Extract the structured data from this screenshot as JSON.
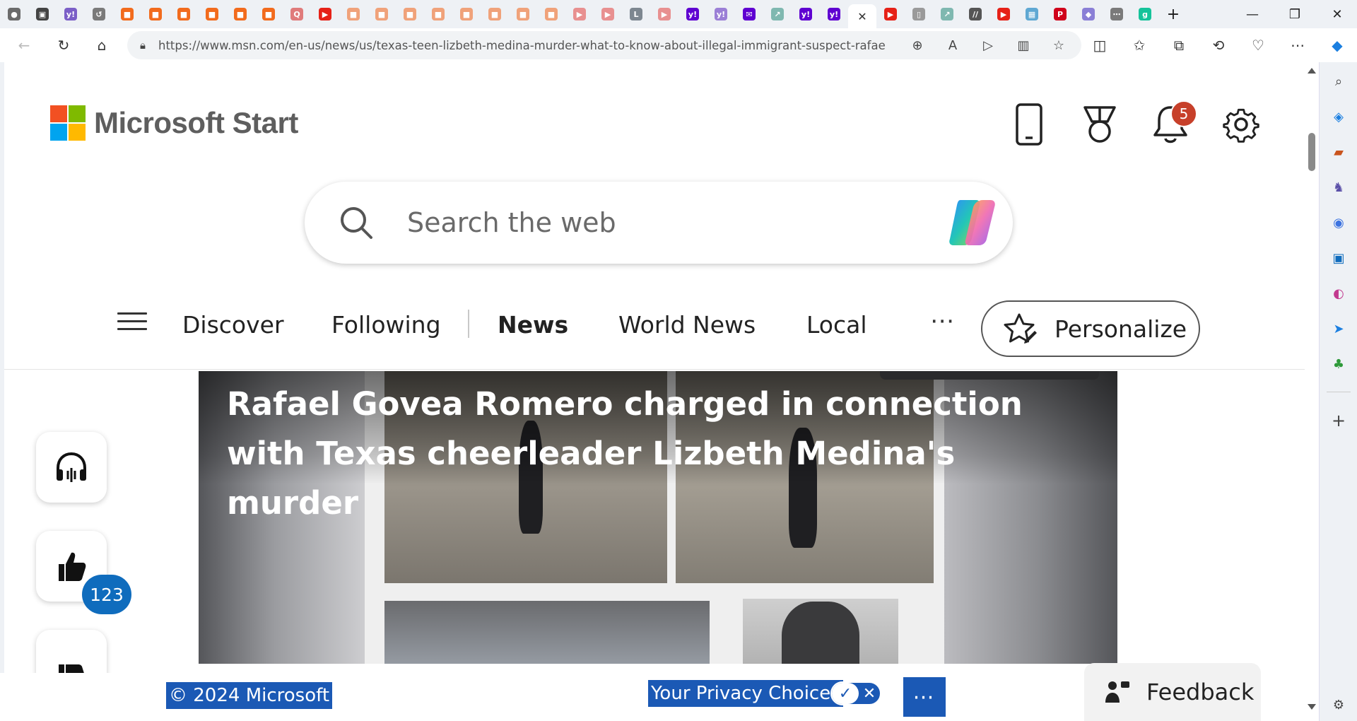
{
  "browser": {
    "url": "https://www.msn.com/en-us/news/us/texas-teen-lizbeth-medina-murder-what-to-know-about-illegal-immigrant-suspect-rafael-ro...",
    "tab_favicons": [
      {
        "name": "profile-icon",
        "color": "#6b6b6b",
        "glyph": "●"
      },
      {
        "name": "tab-actions-icon",
        "color": "#444444",
        "glyph": "▣"
      },
      {
        "name": "yahoo-tab-icon",
        "color": "#7b5fc7",
        "glyph": "y!"
      },
      {
        "name": "history-tab-icon",
        "color": "#7a7a7a",
        "glyph": "↺"
      },
      {
        "name": "bookmark-tab-icon",
        "color": "#f26b1d",
        "glyph": "■"
      },
      {
        "name": "bookmark-tab-icon",
        "color": "#f26b1d",
        "glyph": "■"
      },
      {
        "name": "bookmark-tab-icon",
        "color": "#f26b1d",
        "glyph": "■"
      },
      {
        "name": "bookmark-tab-icon",
        "color": "#f26b1d",
        "glyph": "■"
      },
      {
        "name": "bookmark-tab-icon",
        "color": "#f26b1d",
        "glyph": "■"
      },
      {
        "name": "bookmark-tab-icon",
        "color": "#f26b1d",
        "glyph": "■"
      },
      {
        "name": "search-tab-icon",
        "color": "#e07b7b",
        "glyph": "Q"
      },
      {
        "name": "youtube-tab-icon",
        "color": "#e62117",
        "glyph": "▶"
      },
      {
        "name": "bookmark-tab-icon",
        "color": "#f0a27a",
        "glyph": "■"
      },
      {
        "name": "bookmark-tab-icon",
        "color": "#f0a27a",
        "glyph": "■"
      },
      {
        "name": "bookmark-tab-icon",
        "color": "#f0a27a",
        "glyph": "■"
      },
      {
        "name": "bookmark-tab-icon",
        "color": "#f0a27a",
        "glyph": "■"
      },
      {
        "name": "bookmark-tab-icon",
        "color": "#f0a27a",
        "glyph": "■"
      },
      {
        "name": "bookmark-tab-icon",
        "color": "#f0a27a",
        "glyph": "■"
      },
      {
        "name": "bookmark-tab-icon",
        "color": "#f0a27a",
        "glyph": "■"
      },
      {
        "name": "bookmark-tab-icon",
        "color": "#f0a27a",
        "glyph": "■"
      },
      {
        "name": "youtube-tab-icon",
        "color": "#e89090",
        "glyph": "▶"
      },
      {
        "name": "youtube-tab-icon",
        "color": "#e89090",
        "glyph": "▶"
      },
      {
        "name": "letter-tab-icon",
        "color": "#7d8790",
        "glyph": "L"
      },
      {
        "name": "youtube-tab-icon",
        "color": "#e89090",
        "glyph": "▶"
      },
      {
        "name": "yahoo-tab-icon",
        "color": "#5f01d1",
        "glyph": "y!"
      },
      {
        "name": "yahoo-tab-icon",
        "color": "#9b7fd6",
        "glyph": "y!"
      },
      {
        "name": "yahoo-mail-tab-icon",
        "color": "#5f01d1",
        "glyph": "✉"
      },
      {
        "name": "arrow-tab-icon",
        "color": "#7fb8b0",
        "glyph": "↗"
      },
      {
        "name": "yahoo-tab-icon",
        "color": "#5f01d1",
        "glyph": "y!"
      },
      {
        "name": "yahoo-tab-icon",
        "color": "#5f01d1",
        "glyph": "y!"
      }
    ],
    "tab_favicons_after": [
      {
        "name": "youtube-tab-icon",
        "color": "#e62117",
        "glyph": "▶"
      },
      {
        "name": "page-tab-icon",
        "color": "#9a9a9a",
        "glyph": "▯"
      },
      {
        "name": "arrow-tab-icon",
        "color": "#7fb8b0",
        "glyph": "↗"
      },
      {
        "name": "slash-tab-icon",
        "color": "#555555",
        "glyph": "//"
      },
      {
        "name": "youtube-tab-icon",
        "color": "#e62117",
        "glyph": "▶"
      },
      {
        "name": "image-tab-icon",
        "color": "#5fa8d3",
        "glyph": "▦"
      },
      {
        "name": "pinterest-tab-icon",
        "color": "#d0021b",
        "glyph": "P"
      },
      {
        "name": "shield-tab-icon",
        "color": "#8a7fd6",
        "glyph": "◆"
      },
      {
        "name": "dots-tab-icon",
        "color": "#7a7a7a",
        "glyph": "⋯"
      },
      {
        "name": "grammarly-tab-icon",
        "color": "#15c39a",
        "glyph": "g"
      }
    ]
  },
  "header": {
    "brand": "Microsoft Start",
    "notification_count": "5",
    "logo_colors": [
      "#f25022",
      "#7fba00",
      "#00a4ef",
      "#ffb900"
    ]
  },
  "search": {
    "placeholder": "Search the web"
  },
  "nav": {
    "items": [
      "Discover",
      "Following",
      "News",
      "World News",
      "Local"
    ],
    "active": "News",
    "personalize": "Personalize"
  },
  "article": {
    "headline": "Rafael Govea Romero charged in connection with Texas cheerleader Lizbeth Medina's murder",
    "like_count": "123"
  },
  "footer": {
    "copyright": "© 2024 Microsoft",
    "privacy": "Your Privacy Choices",
    "feedback": "Feedback",
    "accent": "#1b59b5"
  }
}
